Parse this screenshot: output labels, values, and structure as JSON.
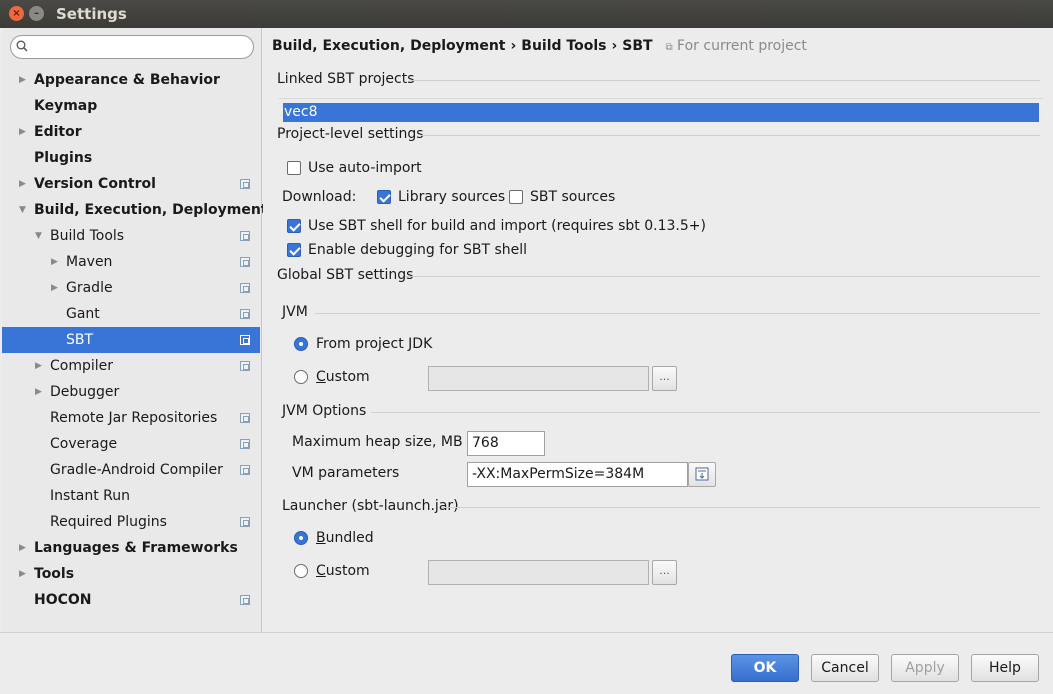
{
  "window": {
    "title": "Settings"
  },
  "search": {
    "placeholder": ""
  },
  "sidebar": {
    "items": [
      {
        "label": "Appearance & Behavior",
        "level": 0,
        "bold": true,
        "arrow": "right",
        "project": false
      },
      {
        "label": "Keymap",
        "level": 0,
        "bold": true,
        "arrow": "",
        "project": false
      },
      {
        "label": "Editor",
        "level": 0,
        "bold": true,
        "arrow": "right",
        "project": false
      },
      {
        "label": "Plugins",
        "level": 0,
        "bold": true,
        "arrow": "",
        "project": false
      },
      {
        "label": "Version Control",
        "level": 0,
        "bold": true,
        "arrow": "right",
        "project": true
      },
      {
        "label": "Build, Execution, Deployment",
        "level": 0,
        "bold": true,
        "arrow": "down",
        "project": false
      },
      {
        "label": "Build Tools",
        "level": 1,
        "bold": false,
        "arrow": "down",
        "project": true
      },
      {
        "label": "Maven",
        "level": 2,
        "bold": false,
        "arrow": "right",
        "project": true
      },
      {
        "label": "Gradle",
        "level": 2,
        "bold": false,
        "arrow": "right",
        "project": true
      },
      {
        "label": "Gant",
        "level": 2,
        "bold": false,
        "arrow": "",
        "project": true
      },
      {
        "label": "SBT",
        "level": 2,
        "bold": false,
        "arrow": "",
        "project": true,
        "selected": true
      },
      {
        "label": "Compiler",
        "level": 1,
        "bold": false,
        "arrow": "right",
        "project": true
      },
      {
        "label": "Debugger",
        "level": 1,
        "bold": false,
        "arrow": "right",
        "project": false
      },
      {
        "label": "Remote Jar Repositories",
        "level": 1,
        "bold": false,
        "arrow": "",
        "project": true
      },
      {
        "label": "Coverage",
        "level": 1,
        "bold": false,
        "arrow": "",
        "project": true
      },
      {
        "label": "Gradle-Android Compiler",
        "level": 1,
        "bold": false,
        "arrow": "",
        "project": true
      },
      {
        "label": "Instant Run",
        "level": 1,
        "bold": false,
        "arrow": "",
        "project": false
      },
      {
        "label": "Required Plugins",
        "level": 1,
        "bold": false,
        "arrow": "",
        "project": true
      },
      {
        "label": "Languages & Frameworks",
        "level": 0,
        "bold": true,
        "arrow": "right",
        "project": false
      },
      {
        "label": "Tools",
        "level": 0,
        "bold": true,
        "arrow": "right",
        "project": false
      },
      {
        "label": "HOCON",
        "level": 0,
        "bold": true,
        "arrow": "",
        "project": true
      }
    ]
  },
  "breadcrumb": {
    "part1": "Build, Execution, Deployment",
    "sep": "›",
    "part2": "Build Tools",
    "part3": "SBT",
    "scope": "For current project"
  },
  "linked": {
    "title": "Linked SBT projects",
    "selected_project": "vec8"
  },
  "project_settings": {
    "title": "Project-level settings",
    "auto_import": "Use auto-import",
    "download_label": "Download:",
    "library_sources": "Library sources",
    "sbt_sources": "SBT sources",
    "use_shell": "Use SBT shell for build and import (requires sbt 0.13.5+)",
    "enable_debugging": "Enable debugging for SBT shell"
  },
  "global_settings": {
    "title": "Global SBT settings",
    "jvm_title": "JVM",
    "from_project_jdk": "From project JDK",
    "custom": "Custom",
    "custom_jdk_value": "",
    "jvm_options_title": "JVM Options",
    "max_heap_label": "Maximum heap size, MB",
    "max_heap_value": "768",
    "vm_params_label": "VM parameters",
    "vm_params_value": "-XX:MaxPermSize=384M",
    "launcher_title": "Launcher (sbt-launch.jar)",
    "bundled": "Bundled",
    "launcher_custom": "Custom",
    "launcher_custom_value": "",
    "browse": "..."
  },
  "footer": {
    "ok": "OK",
    "cancel": "Cancel",
    "apply": "Apply",
    "help": "Help"
  },
  "colors": {
    "accent": "#3875d7",
    "titlebar": "#3c3b37",
    "close": "#f0683b"
  }
}
